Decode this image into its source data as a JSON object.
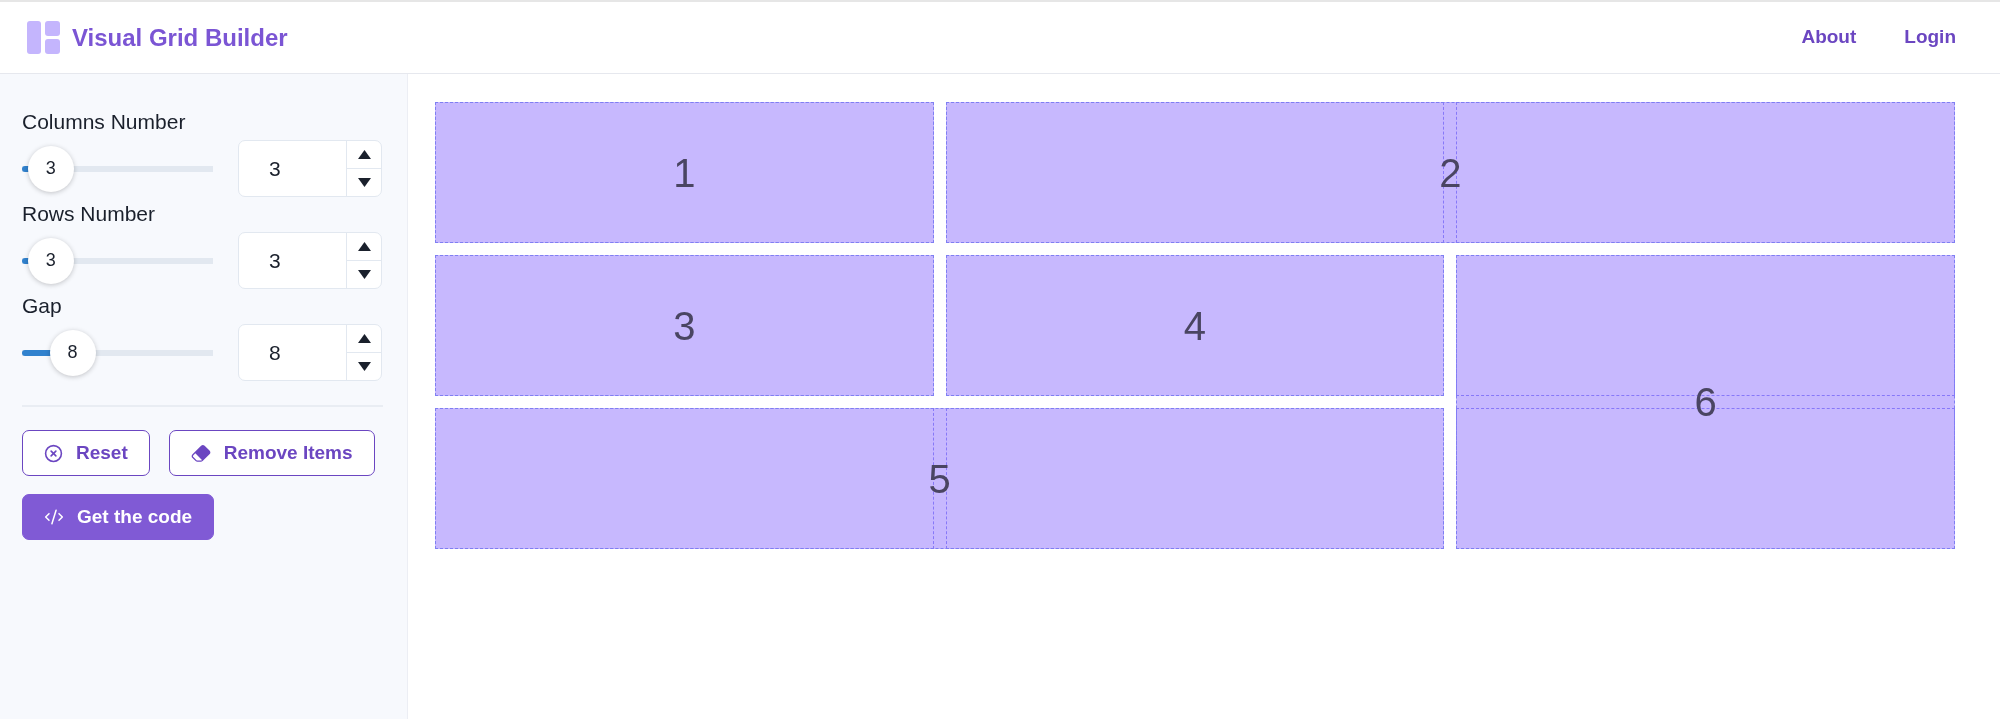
{
  "header": {
    "title": "Visual Grid Builder",
    "links": [
      "About",
      "Login"
    ]
  },
  "controls": [
    {
      "label": "Columns Number",
      "thumb_label": "3",
      "level": 0.04,
      "value": "3"
    },
    {
      "label": "Rows Number",
      "thumb_label": "3",
      "level": 0.04,
      "value": "3"
    },
    {
      "label": "Gap",
      "thumb_label": "8",
      "level": 0.19,
      "value": "8"
    }
  ],
  "buttons": [
    {
      "label": "Reset",
      "kind": "outline"
    },
    {
      "label": "Remove Items",
      "kind": "outline"
    },
    {
      "label": "Get the code",
      "kind": "solid"
    }
  ],
  "grid": {
    "items": [
      {
        "label": "1",
        "kind": "single"
      },
      {
        "label": "2",
        "kind": "wide"
      },
      {
        "label": "3",
        "kind": "single"
      },
      {
        "label": "4",
        "kind": "single"
      },
      {
        "label": "5",
        "kind": "wide"
      },
      {
        "label": "6",
        "kind": "tall"
      }
    ]
  }
}
